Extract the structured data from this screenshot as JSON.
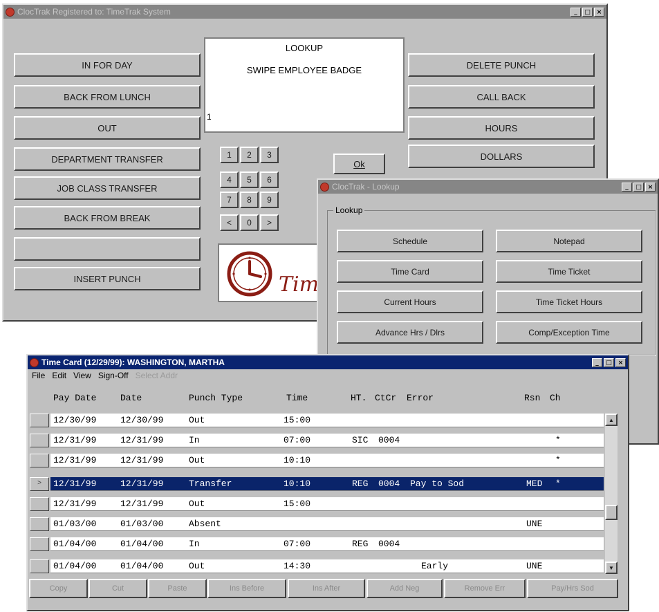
{
  "main_window": {
    "title": "ClocTrak    Registered to: TimeTrak System",
    "min": "_",
    "max": "□",
    "close": "×",
    "left_buttons": [
      "IN FOR DAY",
      "BACK FROM LUNCH",
      "OUT",
      "DEPARTMENT TRANSFER",
      "JOB CLASS TRANSFER",
      "BACK FROM BREAK",
      "",
      "INSERT PUNCH"
    ],
    "display": {
      "heading": "LOOKUP",
      "instruction": "SWIPE EMPLOYEE BADGE",
      "entry": "1"
    },
    "keypad": [
      "1",
      "2",
      "3",
      "4",
      "5",
      "6",
      "7",
      "8",
      "9",
      "<",
      "0",
      ">"
    ],
    "ok_label": "Ok",
    "right_buttons": [
      "DELETE PUNCH",
      "CALL BACK",
      "HOURS",
      "DOLLARS"
    ],
    "logo_text": "Tim"
  },
  "lookup_window": {
    "title": "ClocTrak - Lookup",
    "min": "_",
    "max": "□",
    "close": "×",
    "group_label": "Lookup",
    "buttons": [
      "Schedule",
      "Notepad",
      "Time Card",
      "Time Ticket",
      "Current Hours",
      "Time Ticket Hours",
      "Advance Hrs / Dlrs",
      "Comp/Exception Time"
    ]
  },
  "timecard_window": {
    "title": "Time Card (12/29/99): WASHINGTON, MARTHA",
    "min": "_",
    "max": "□",
    "close": "×",
    "menu": [
      "File",
      "Edit",
      "View",
      "Sign-Off"
    ],
    "menu_disabled": "Select Addr",
    "columns": [
      "Pay Date",
      "Date",
      "Punch Type",
      "Time",
      "HT.",
      "CtCr",
      "Error",
      "Rsn",
      "Ch"
    ],
    "rows": [
      {
        "pay_date": "12/30/99",
        "date": "12/30/99",
        "punch": "Out",
        "time": "15:00",
        "ht": "",
        "ctcr": "",
        "error": "",
        "rsn": "",
        "ch": ""
      },
      {
        "pay_date": "12/31/99",
        "date": "12/31/99",
        "punch": "In",
        "time": "07:00",
        "ht": "SIC",
        "ctcr": "0004",
        "error": "",
        "rsn": "",
        "ch": "*"
      },
      {
        "pay_date": "12/31/99",
        "date": "12/31/99",
        "punch": "Out",
        "time": "10:10",
        "ht": "",
        "ctcr": "",
        "error": "",
        "rsn": "",
        "ch": "*"
      },
      {
        "pay_date": "12/31/99",
        "date": "12/31/99",
        "punch": "Transfer",
        "time": "10:10",
        "ht": "REG",
        "ctcr": "0004",
        "error": "Pay to Sod",
        "rsn": "MED",
        "ch": "*"
      },
      {
        "pay_date": "12/31/99",
        "date": "12/31/99",
        "punch": "Out",
        "time": "15:00",
        "ht": "",
        "ctcr": "",
        "error": "",
        "rsn": "",
        "ch": ""
      },
      {
        "pay_date": "01/03/00",
        "date": "01/03/00",
        "punch": "Absent",
        "time": "",
        "ht": "",
        "ctcr": "",
        "error": "",
        "rsn": "UNE",
        "ch": ""
      },
      {
        "pay_date": "01/04/00",
        "date": "01/04/00",
        "punch": "In",
        "time": "07:00",
        "ht": "REG",
        "ctcr": "0004",
        "error": "",
        "rsn": "",
        "ch": ""
      },
      {
        "pay_date": "01/04/00",
        "date": "01/04/00",
        "punch": "Out",
        "time": "14:30",
        "ht": "",
        "ctcr": "",
        "error": "Early",
        "rsn": "UNE",
        "ch": ""
      }
    ],
    "selected_row_marker": ">",
    "bottom_buttons": [
      "Copy",
      "Cut",
      "Paste",
      "Ins Before",
      "Ins After",
      "Add Neg",
      "Remove Err",
      "Pay/Hrs Sod"
    ],
    "scroll_up": "▲",
    "scroll_down": "▼"
  }
}
